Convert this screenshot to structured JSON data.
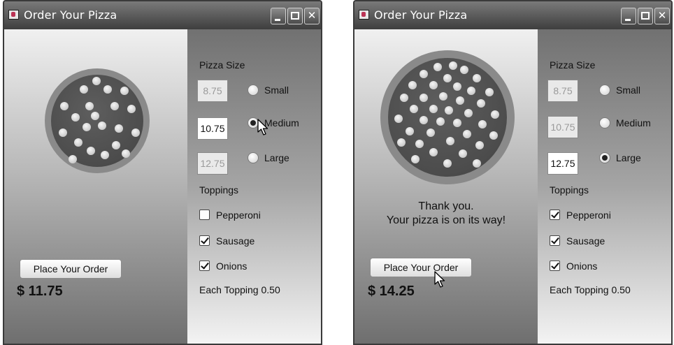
{
  "windows": [
    {
      "title": "Order Your Pizza",
      "pizza_size_label": "Pizza Size",
      "sizes": [
        {
          "price": "8.75",
          "label": "Small",
          "selected": false
        },
        {
          "price": "10.75",
          "label": "Medium",
          "selected": true
        },
        {
          "price": "12.75",
          "label": "Large",
          "selected": false
        }
      ],
      "toppings_label": "Toppings",
      "toppings": [
        {
          "label": "Pepperoni",
          "checked": false
        },
        {
          "label": "Sausage",
          "checked": true
        },
        {
          "label": "Onions",
          "checked": true
        }
      ],
      "topping_price_note": "Each Topping 0.50",
      "order_button": "Place Your Order",
      "total": "$ 11.75",
      "message_line1": "",
      "message_line2": ""
    },
    {
      "title": "Order Your Pizza",
      "pizza_size_label": "Pizza Size",
      "sizes": [
        {
          "price": "8.75",
          "label": "Small",
          "selected": false
        },
        {
          "price": "10.75",
          "label": "Medium",
          "selected": false
        },
        {
          "price": "12.75",
          "label": "Large",
          "selected": true
        }
      ],
      "toppings_label": "Toppings",
      "toppings": [
        {
          "label": "Pepperoni",
          "checked": true
        },
        {
          "label": "Sausage",
          "checked": true
        },
        {
          "label": "Onions",
          "checked": true
        }
      ],
      "topping_price_note": "Each Topping 0.50",
      "order_button": "Place Your Order",
      "total": "$ 14.25",
      "message_line1": "Thank you.",
      "message_line2": "Your pizza is on its way!"
    }
  ],
  "icons": {
    "app": "java-cup-icon",
    "minimize": "minimize-icon",
    "maximize": "maximize-icon",
    "close": "close-icon",
    "cursor": "mouse-pointer-icon"
  }
}
